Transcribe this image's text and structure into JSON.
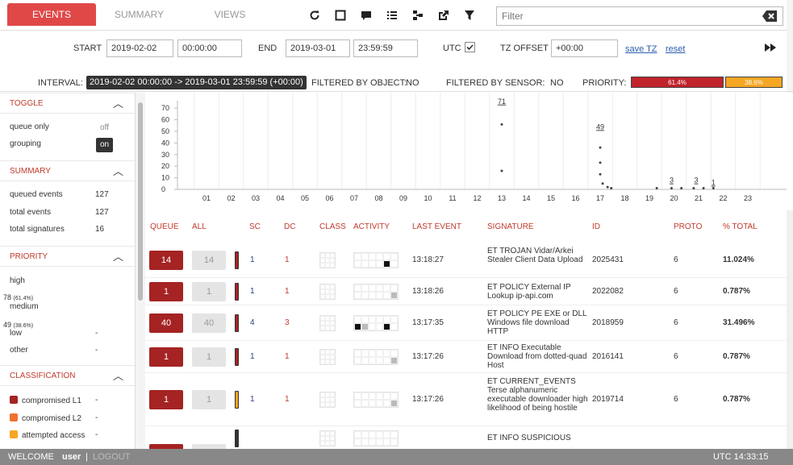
{
  "tabs": {
    "events": "EVENTS",
    "summary": "SUMMARY",
    "views": "VIEWS"
  },
  "toolbar_icons": [
    "refresh-icon",
    "fullscreen-icon",
    "comment-icon",
    "list-icon",
    "tree-icon",
    "export-icon",
    "filter-icon"
  ],
  "filter": {
    "placeholder": "Filter",
    "value": ""
  },
  "dates": {
    "start_label": "START",
    "start_date": "2019-02-02",
    "start_time": "00:00:00",
    "end_label": "END",
    "end_date": "2019-03-01",
    "end_time": "23:59:59",
    "utc_label": "UTC",
    "utc_checked": true,
    "tz_label": "TZ OFFSET",
    "tz_value": "+00:00",
    "save_tz": "save TZ",
    "reset": "reset"
  },
  "interval": {
    "label": "INTERVAL:",
    "value": "2019-02-02 00:00:00 -> 2019-03-01 23:59:59 (+00:00)",
    "by_object_label": "FILTERED BY OBJECT:",
    "by_object_value": "NO",
    "by_sensor_label": "FILTERED BY SENSOR:",
    "by_sensor_value": "NO",
    "priority_label": "PRIORITY:",
    "priority_bars": [
      {
        "label": "61.4%",
        "color": "#c0232b",
        "fraction": 0.614
      },
      {
        "label": "38.6%",
        "color": "#f5a623",
        "fraction": 0.386
      }
    ]
  },
  "sidebar": {
    "toggle": {
      "title": "TOGGLE",
      "queue_only_label": "queue only",
      "queue_only_value": "off",
      "grouping_label": "grouping",
      "grouping_value": "on"
    },
    "summary": {
      "title": "SUMMARY",
      "rows": [
        {
          "label": "queued events",
          "value": "127"
        },
        {
          "label": "total events",
          "value": "127"
        },
        {
          "label": "total signatures",
          "value": "16"
        }
      ]
    },
    "priority": {
      "title": "PRIORITY",
      "rows": [
        {
          "label": "high",
          "count": "",
          "pct": "",
          "dash": ""
        },
        {
          "label": "medium",
          "count": "78",
          "pct": "(61.4%)",
          "dash": ""
        },
        {
          "label": "low",
          "count": "49",
          "pct": "(38.6%)",
          "dash": "-"
        },
        {
          "label": "other",
          "count": "",
          "pct": "",
          "dash": "-"
        }
      ]
    },
    "classification": {
      "title": "CLASSIFICATION",
      "rows": [
        {
          "label": "compromised L1",
          "dash": "-",
          "color": "#a52323"
        },
        {
          "label": "compromised L2",
          "dash": "-",
          "color": "#f07030"
        },
        {
          "label": "attempted access",
          "dash": "-",
          "color": "#f5a623"
        }
      ]
    }
  },
  "chart_data": {
    "type": "scatter",
    "x_ticks": [
      "01",
      "02",
      "03",
      "04",
      "05",
      "06",
      "07",
      "08",
      "09",
      "10",
      "11",
      "12",
      "13",
      "14",
      "15",
      "16",
      "17",
      "18",
      "19",
      "20",
      "21",
      "22",
      "23"
    ],
    "y_ticks": [
      0,
      10,
      20,
      30,
      40,
      50,
      60,
      70
    ],
    "ylim": [
      0,
      75
    ],
    "points": [
      {
        "x": 13.0,
        "y": 56
      },
      {
        "x": 13.0,
        "y": 16
      },
      {
        "x": 17.0,
        "y": 36
      },
      {
        "x": 17.0,
        "y": 23
      },
      {
        "x": 17.0,
        "y": 13
      },
      {
        "x": 17.1,
        "y": 5
      },
      {
        "x": 17.3,
        "y": 2
      },
      {
        "x": 17.45,
        "y": 1
      },
      {
        "x": 19.3,
        "y": 1
      },
      {
        "x": 19.9,
        "y": 1
      },
      {
        "x": 20.3,
        "y": 1
      },
      {
        "x": 20.8,
        "y": 1
      },
      {
        "x": 21.2,
        "y": 1
      },
      {
        "x": 21.6,
        "y": 1
      }
    ],
    "data_labels": [
      {
        "x": 13.0,
        "y": 71,
        "text": "71"
      },
      {
        "x": 17.0,
        "y": 49,
        "text": "49"
      },
      {
        "x": 19.9,
        "y": 3,
        "text": "3"
      },
      {
        "x": 20.9,
        "y": 3,
        "text": "3"
      },
      {
        "x": 21.6,
        "y": 1,
        "text": "1"
      }
    ]
  },
  "table": {
    "headers": [
      "QUEUE",
      "ALL",
      "SC",
      "DC",
      "CLASS",
      "ACTIVITY",
      "LAST EVENT",
      "SIGNATURE",
      "ID",
      "PROTO",
      "% TOTAL"
    ],
    "rows": [
      {
        "queue": "14",
        "all": "14",
        "prio_color": "#a52323",
        "sc": "1",
        "dc": "1",
        "activity": [
          0,
          0,
          0,
          0,
          1,
          0
        ],
        "last_event": "13:18:27",
        "signature": "ET TROJAN Vidar/Arkei Stealer Client Data Upload",
        "id": "2025431",
        "proto": "6",
        "total": "11.024%"
      },
      {
        "queue": "1",
        "all": "1",
        "prio_color": "#a52323",
        "sc": "1",
        "dc": "1",
        "activity": [
          0,
          0,
          0,
          0,
          0,
          2
        ],
        "last_event": "13:18:26",
        "signature": "ET POLICY External IP Lookup ip-api.com",
        "id": "2022082",
        "proto": "6",
        "total": "0.787%"
      },
      {
        "queue": "40",
        "all": "40",
        "prio_color": "#a52323",
        "sc": "4",
        "dc": "3",
        "activity": [
          1,
          2,
          0,
          0,
          1,
          0
        ],
        "last_event": "13:17:35",
        "signature": "ET POLICY PE EXE or DLL Windows file download HTTP",
        "id": "2018959",
        "proto": "6",
        "total": "31.496%"
      },
      {
        "queue": "1",
        "all": "1",
        "prio_color": "#a52323",
        "sc": "1",
        "dc": "1",
        "activity": [
          0,
          0,
          0,
          0,
          0,
          2
        ],
        "last_event": "13:17:26",
        "signature": "ET INFO Executable Download from dotted-quad Host",
        "id": "2016141",
        "proto": "6",
        "total": "0.787%"
      },
      {
        "queue": "1",
        "all": "1",
        "prio_color": "#f5a623",
        "sc": "1",
        "dc": "1",
        "activity": [
          0,
          0,
          0,
          0,
          0,
          2
        ],
        "last_event": "13:17:26",
        "signature": "ET CURRENT_EVENTS Terse alphanumeric executable downloader high likelihood of being hostile",
        "id": "2019714",
        "proto": "6",
        "total": "0.787%"
      },
      {
        "queue": "",
        "all": "",
        "prio_color": "#333333",
        "sc": "",
        "dc": "",
        "activity": [
          0,
          0,
          0,
          0,
          0,
          0
        ],
        "last_event": "",
        "signature": "ET INFO SUSPICIOUS",
        "id": "",
        "proto": "",
        "total": ""
      }
    ]
  },
  "footer": {
    "welcome": "WELCOME",
    "user": "user",
    "separator": "|",
    "logout": "LOGOUT",
    "clock": "UTC 14:33:15"
  }
}
